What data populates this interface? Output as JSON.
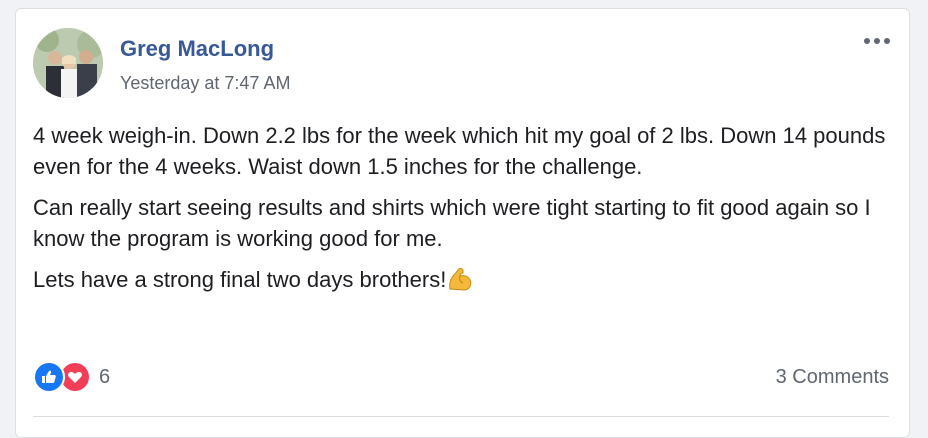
{
  "post": {
    "author": "Greg MacLong",
    "timestamp": "Yesterday at 7:47 AM",
    "paragraphs": [
      "4 week weigh-in. Down 2.2 lbs for the week which hit my goal of 2 lbs. Down 14 pounds even for the 4 weeks. Waist down 1.5 inches for the challenge.",
      "Can really start seeing results and shirts which were tight starting to fit good again so I know the program is working good for me.",
      "Lets have a strong final two days brothers!"
    ],
    "emoji": "flexed-biceps-icon",
    "reactions": {
      "icons": [
        "like-icon",
        "love-icon"
      ],
      "count": "6"
    },
    "comments": "3 Comments",
    "colors": {
      "author": "#385898",
      "like": "#1877f2",
      "love": "#f33e58",
      "meta": "#606770"
    }
  }
}
